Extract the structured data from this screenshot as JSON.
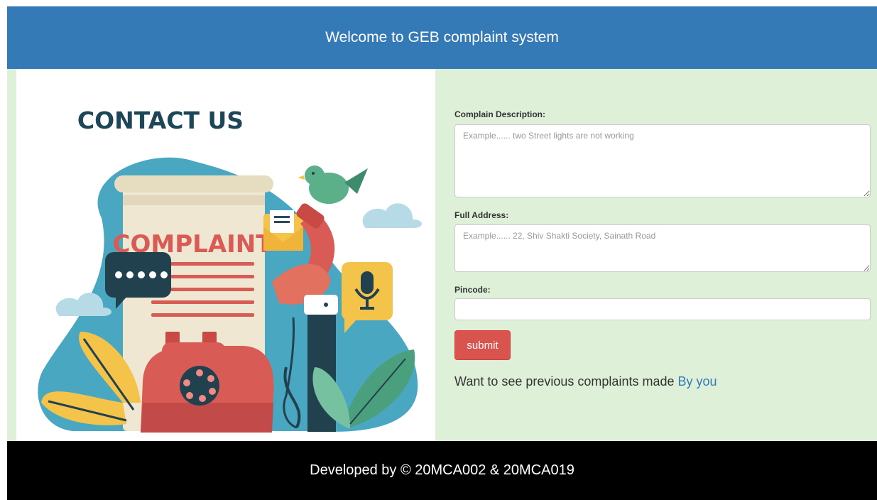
{
  "header": {
    "title": "Welcome to GEB complaint system"
  },
  "illustration": {
    "heading": "CONTACT US",
    "document_word": "COMPLAINT"
  },
  "form": {
    "description_label": "Complain Description:",
    "description_placeholder": "Example...... two Street lights are not working",
    "address_label": "Full Address:",
    "address_placeholder": "Example...... 22, Shiv Shakti Society, Sainath Road",
    "pincode_label": "Pincode:",
    "pincode_value": "",
    "submit_label": "submit"
  },
  "previous": {
    "text": "Want to see previous complaints made ",
    "link_label": "By you"
  },
  "footer": {
    "text": "Developed by © 20MCA002 & 20MCA019"
  },
  "colors": {
    "header_bg": "#337ab7",
    "panel_bg": "#dff0d8",
    "submit_bg": "#d9534f",
    "footer_bg": "#000000",
    "link": "#337ab7"
  }
}
